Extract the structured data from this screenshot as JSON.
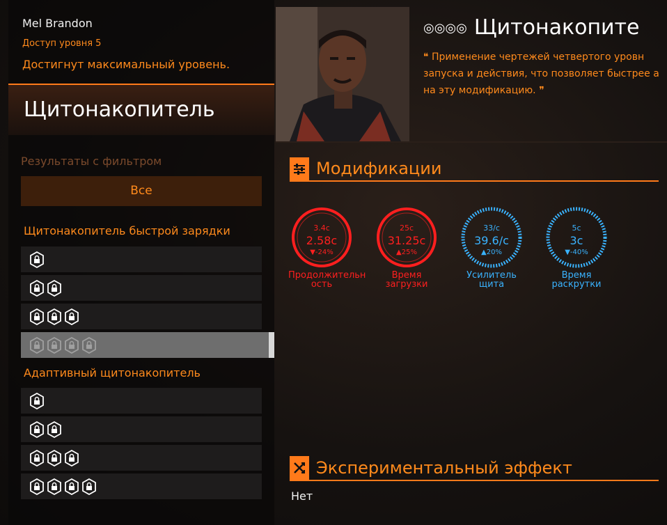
{
  "player": {
    "name": "Mel Brandon",
    "access": "Доступ уровня 5",
    "status": "Достигнут максимальный уровень."
  },
  "category_title": "Щитонакопитель",
  "filter": {
    "label": "Результаты с фильтром",
    "button": "Все"
  },
  "groups": [
    {
      "title": "Щитонакопитель быстрой зарядки",
      "tiers": [
        1,
        2,
        3,
        4
      ],
      "selected_tier": 4
    },
    {
      "title": "Адаптивный щитонакопитель",
      "tiers": [
        1,
        2,
        3,
        4
      ],
      "selected_tier": null
    }
  ],
  "detail": {
    "tier_icons": "◎◎◎◎",
    "title": "Щитонакопите",
    "quote_open": "❝",
    "quote_close": "❞",
    "quote_lines": [
      "Применение чертежей четвертого уровн",
      "запуска и действия, что позволяет быстрее а",
      "на эту модификацию."
    ]
  },
  "modifications": {
    "title": "Модификации",
    "icon": "sliders-icon",
    "stats": [
      {
        "base": "3.4с",
        "value": "2.58с",
        "delta": "▼-24%",
        "label": "Продолжительн ость",
        "color": "#ff1f1f",
        "style": "red"
      },
      {
        "base": "25с",
        "value": "31.25с",
        "delta": "▲25%",
        "label": "Время загрузки",
        "color": "#ff1f1f",
        "style": "red"
      },
      {
        "base": "33/с",
        "value": "39.6/с",
        "delta": "▲20%",
        "label": "Усилитель щита",
        "color": "#3ab3ff",
        "style": "blue"
      },
      {
        "base": "5с",
        "value": "3с",
        "delta": "▼-40%",
        "label": "Время раскрутки",
        "color": "#3ab3ff",
        "style": "blue"
      }
    ]
  },
  "experimental": {
    "title": "Экспериментальный эффект",
    "icon": "crossed-arrows-icon",
    "value": "Нет"
  },
  "colors": {
    "accent": "#ff7a1a",
    "negative": "#ff1f1f",
    "positive": "#3ab3ff"
  }
}
